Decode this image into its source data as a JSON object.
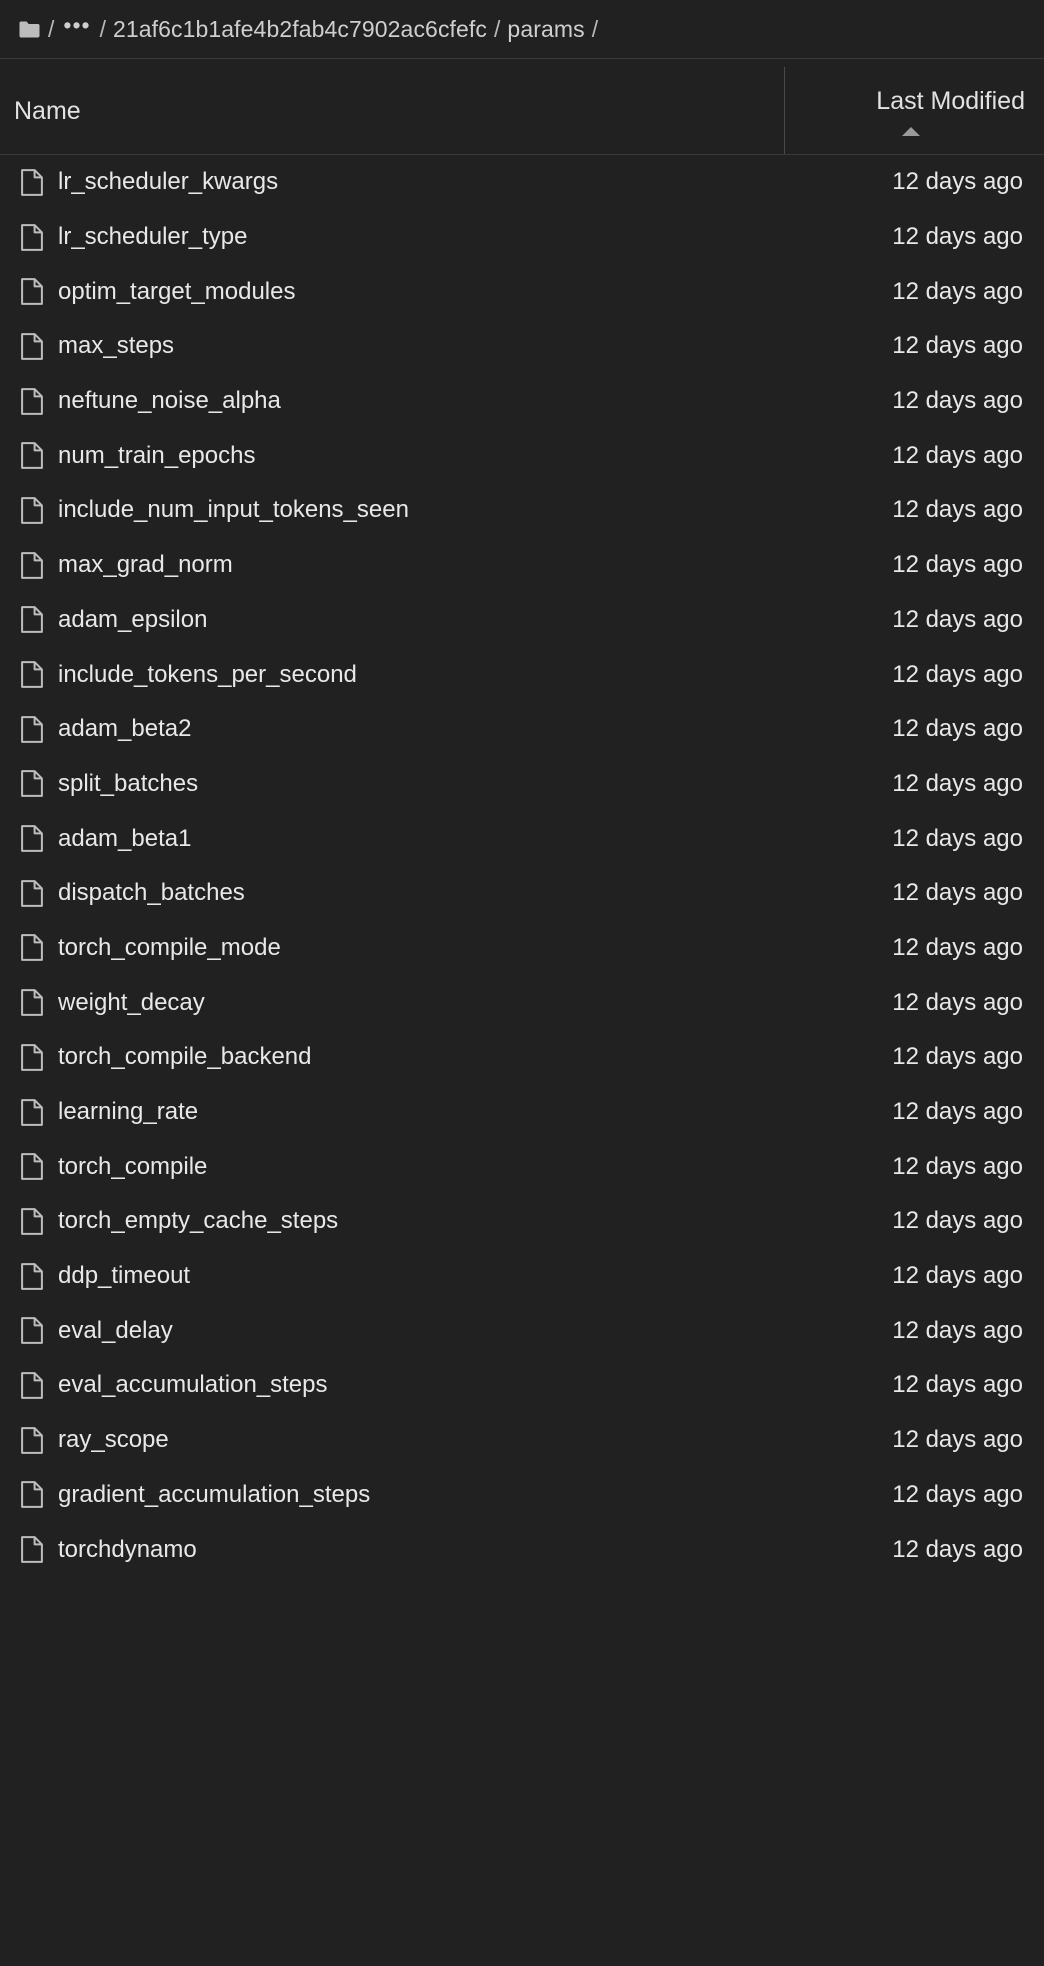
{
  "breadcrumb": {
    "root_icon": "folder-icon",
    "separator": "/",
    "ellipsis": "•••",
    "segments": [
      {
        "label": "21af6c1b1afe4b2fab4c7902ac6cfefc"
      },
      {
        "label": "params"
      }
    ]
  },
  "table": {
    "columns": {
      "name": "Name",
      "last_modified": "Last Modified"
    },
    "sort": {
      "column": "Last Modified",
      "direction": "ascending",
      "icon": "caret-up-icon"
    },
    "rows": [
      {
        "icon": "file-icon",
        "name": "lr_scheduler_kwargs",
        "modified": "12 days ago"
      },
      {
        "icon": "file-icon",
        "name": "lr_scheduler_type",
        "modified": "12 days ago"
      },
      {
        "icon": "file-icon",
        "name": "optim_target_modules",
        "modified": "12 days ago"
      },
      {
        "icon": "file-icon",
        "name": "max_steps",
        "modified": "12 days ago"
      },
      {
        "icon": "file-icon",
        "name": "neftune_noise_alpha",
        "modified": "12 days ago"
      },
      {
        "icon": "file-icon",
        "name": "num_train_epochs",
        "modified": "12 days ago"
      },
      {
        "icon": "file-icon",
        "name": "include_num_input_tokens_seen",
        "modified": "12 days ago"
      },
      {
        "icon": "file-icon",
        "name": "max_grad_norm",
        "modified": "12 days ago"
      },
      {
        "icon": "file-icon",
        "name": "adam_epsilon",
        "modified": "12 days ago"
      },
      {
        "icon": "file-icon",
        "name": "include_tokens_per_second",
        "modified": "12 days ago"
      },
      {
        "icon": "file-icon",
        "name": "adam_beta2",
        "modified": "12 days ago"
      },
      {
        "icon": "file-icon",
        "name": "split_batches",
        "modified": "12 days ago"
      },
      {
        "icon": "file-icon",
        "name": "adam_beta1",
        "modified": "12 days ago"
      },
      {
        "icon": "file-icon",
        "name": "dispatch_batches",
        "modified": "12 days ago"
      },
      {
        "icon": "file-icon",
        "name": "torch_compile_mode",
        "modified": "12 days ago"
      },
      {
        "icon": "file-icon",
        "name": "weight_decay",
        "modified": "12 days ago"
      },
      {
        "icon": "file-icon",
        "name": "torch_compile_backend",
        "modified": "12 days ago"
      },
      {
        "icon": "file-icon",
        "name": "learning_rate",
        "modified": "12 days ago"
      },
      {
        "icon": "file-icon",
        "name": "torch_compile",
        "modified": "12 days ago"
      },
      {
        "icon": "file-icon",
        "name": "torch_empty_cache_steps",
        "modified": "12 days ago"
      },
      {
        "icon": "file-icon",
        "name": "ddp_timeout",
        "modified": "12 days ago"
      },
      {
        "icon": "file-icon",
        "name": "eval_delay",
        "modified": "12 days ago"
      },
      {
        "icon": "file-icon",
        "name": "eval_accumulation_steps",
        "modified": "12 days ago"
      },
      {
        "icon": "file-icon",
        "name": "ray_scope",
        "modified": "12 days ago"
      },
      {
        "icon": "file-icon",
        "name": "gradient_accumulation_steps",
        "modified": "12 days ago"
      },
      {
        "icon": "file-icon",
        "name": "torchdynamo",
        "modified": "12 days ago"
      }
    ]
  },
  "colors": {
    "background": "#212121",
    "row_text": "#e8e8e8",
    "breadcrumb_text": "#cfcfcf",
    "divider": "#3a3a3a",
    "icon_stroke": "#bdbdbd"
  }
}
